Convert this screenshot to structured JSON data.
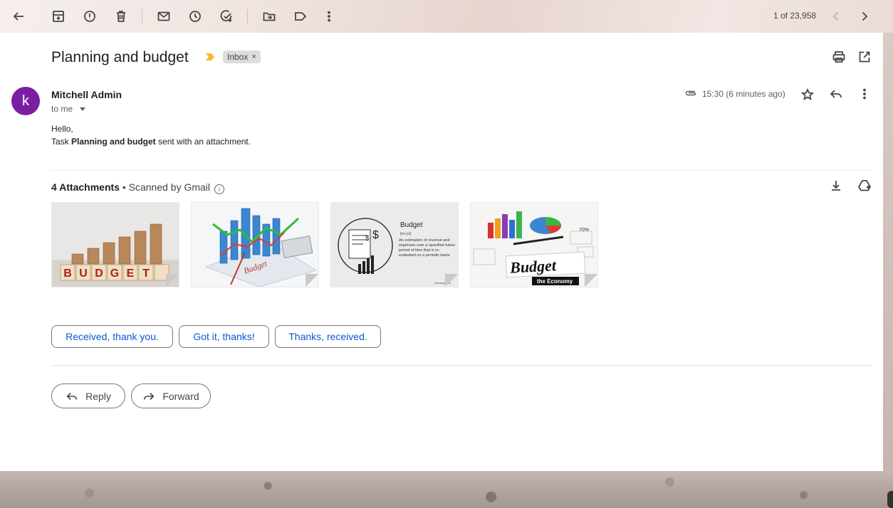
{
  "toolbar": {
    "icons": [
      "back-arrow-icon",
      "archive-icon",
      "report-spam-icon",
      "delete-icon",
      "mark-unread-icon",
      "snooze-icon",
      "add-task-icon",
      "move-to-icon",
      "label-icon",
      "more-vert-icon"
    ],
    "pager_text": "1 of 23,958"
  },
  "email": {
    "subject": "Planning and budget",
    "label_chip": "Inbox",
    "label_remove": "×",
    "sender_initial": "k",
    "sender_name": "Mitchell Admin",
    "recipient": "to me",
    "time": "15:30 (6 minutes ago)",
    "body_greeting": "Hello,",
    "body_prefix": "Task ",
    "body_task": "Planning and budget",
    "body_suffix": " sent with an attachment."
  },
  "attachments": {
    "count_label": "4 Attachments",
    "scan_label": " • Scanned by Gmail",
    "info": "i",
    "items": [
      {
        "name": "budget-blocks",
        "text": "BUDGET"
      },
      {
        "name": "budget-bar-chart",
        "text": "Budget"
      },
      {
        "name": "budget-definition",
        "title": "Budget",
        "pron": "[bə-jət]",
        "definition": "An estimation of revenue and expenses over a specified future period of time that is re-evaluated on a periodic basis.",
        "brand": "Investopedia"
      },
      {
        "name": "budget-economy",
        "text": "Budget",
        "subtext": "the Economy",
        "percent": "70%"
      }
    ]
  },
  "smart_replies": [
    "Received, thank you.",
    "Got it, thanks!",
    "Thanks, received."
  ],
  "actions": {
    "reply": "Reply",
    "forward": "Forward"
  },
  "colors": {
    "avatar": "#7b1fa2",
    "link_blue": "#0b57d0",
    "importance": "#f2bb2f"
  }
}
